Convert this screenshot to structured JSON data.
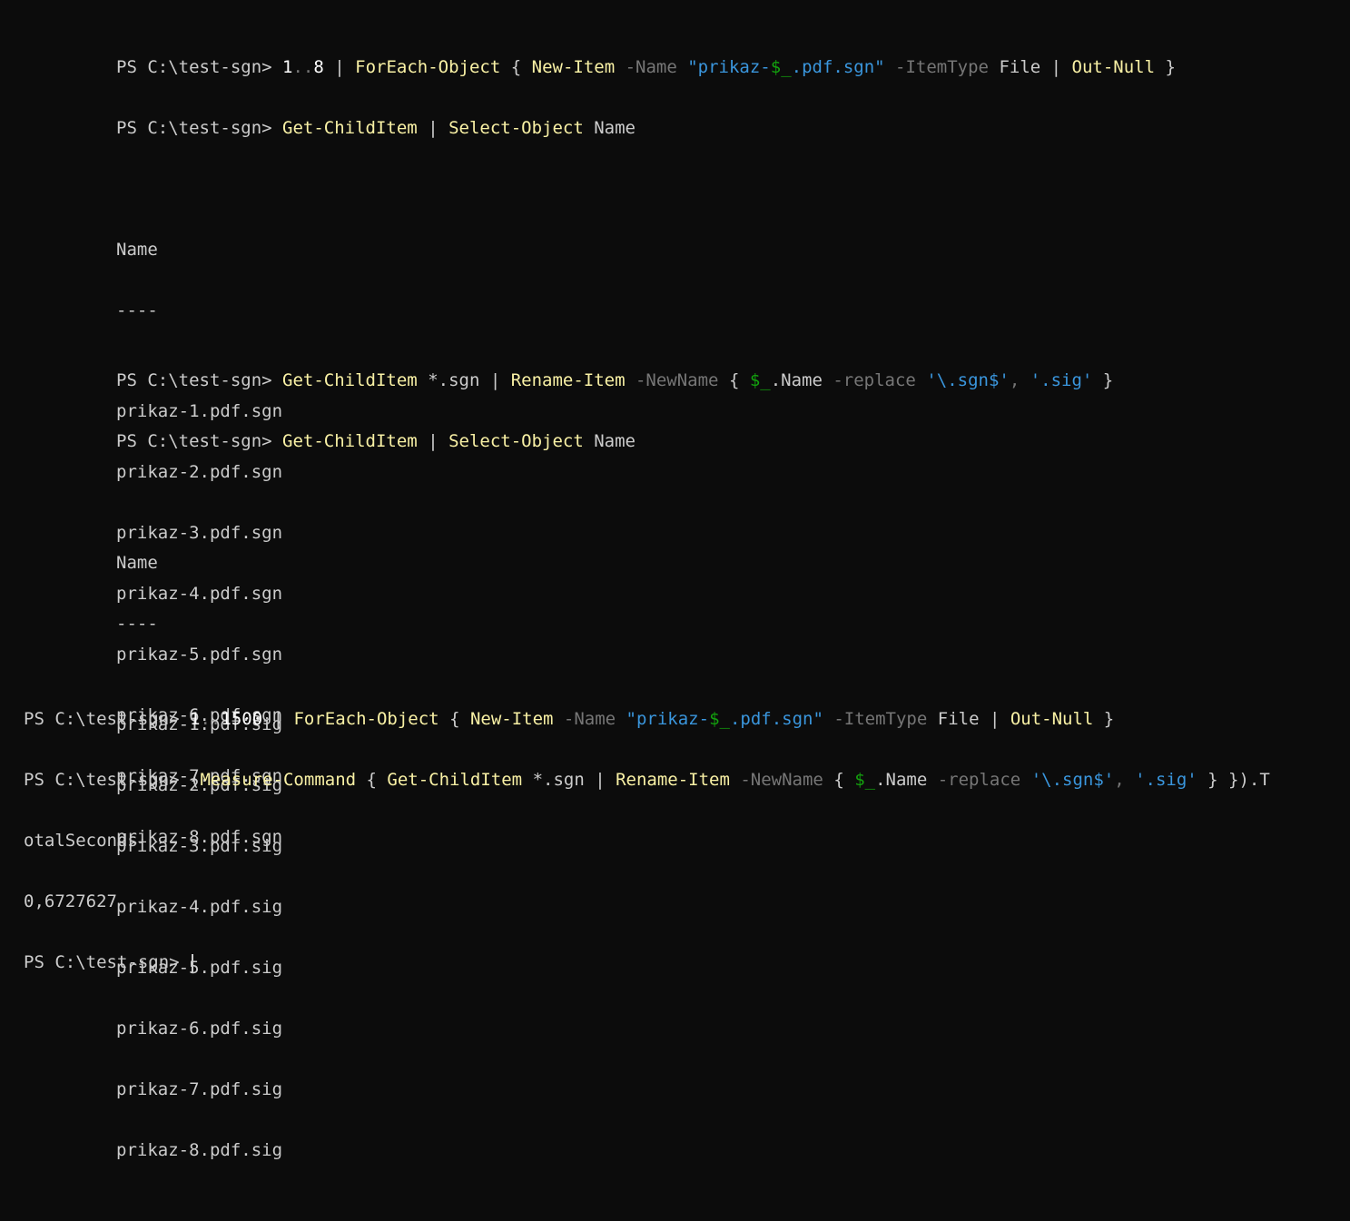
{
  "prompt": "PS C:\\test-sgn> ",
  "session1": {
    "line1": {
      "p1": "1",
      "p2": "..",
      "p3": "8",
      "p4": " | ",
      "p5": "ForEach-Object",
      "p6": " { ",
      "p7": "New-Item",
      "p8": " -Name ",
      "p9": "\"prikaz-",
      "p10": "$_",
      "p11": ".pdf.sgn\"",
      "p12": " -ItemType ",
      "p13": "File",
      "p14": " | ",
      "p15": "Out-Null",
      "p16": " }"
    },
    "line2": {
      "p1": "Get-ChildItem",
      "p2": " | ",
      "p3": "Select-Object",
      "p4": " Name"
    },
    "header": "Name",
    "underline": "----",
    "files": [
      "prikaz-1.pdf.sgn",
      "prikaz-2.pdf.sgn",
      "prikaz-3.pdf.sgn",
      "prikaz-4.pdf.sgn",
      "prikaz-5.pdf.sgn",
      "prikaz-6.pdf.sgn",
      "prikaz-7.pdf.sgn",
      "prikaz-8.pdf.sgn"
    ]
  },
  "session2": {
    "line1": {
      "p1": "Get-ChildItem",
      "p2": " *.sgn | ",
      "p3": "Rename-Item",
      "p4": " -NewName ",
      "p5": "{ ",
      "p6": "$_",
      "p7": ".Name",
      "p8": " -replace ",
      "p9": "'\\.sgn$'",
      "p10": ", ",
      "p11": "'.sig'",
      "p12": " }"
    },
    "line2": {
      "p1": "Get-ChildItem",
      "p2": " | ",
      "p3": "Select-Object",
      "p4": " Name"
    },
    "header": "Name",
    "underline": "----",
    "files": [
      "prikaz-1.pdf.sig",
      "prikaz-2.pdf.sig",
      "prikaz-3.pdf.sig",
      "prikaz-4.pdf.sig",
      "prikaz-5.pdf.sig",
      "prikaz-6.pdf.sig",
      "prikaz-7.pdf.sig",
      "prikaz-8.pdf.sig"
    ]
  },
  "session3": {
    "line1": {
      "p1": "1",
      "p2": "..",
      "p3": "1500",
      "p4": " | ",
      "p5": "ForEach-Object",
      "p6": " { ",
      "p7": "New-Item",
      "p8": " -Name ",
      "p9": "\"prikaz-",
      "p10": "$_",
      "p11": ".pdf.sgn\"",
      "p12": " -ItemType ",
      "p13": "File",
      "p14": " | ",
      "p15": "Out-Null",
      "p16": " }"
    },
    "line2": {
      "p1": "(",
      "p2": "Measure-Command",
      "p3": " { ",
      "p4": "Get-ChildItem",
      "p5": " *.sgn | ",
      "p6": "Rename-Item",
      "p7": " -NewName ",
      "p8": "{ ",
      "p9": "$_",
      "p10": ".Name",
      "p11": " -replace ",
      "p12": "'\\.sgn$'",
      "p13": ", ",
      "p14": "'.sig'",
      "p15": " } }).T"
    },
    "line3": "otalSeconds",
    "result": "0,6727627"
  },
  "colors": {
    "background": "#0c0c0c",
    "foreground": "#cccccc",
    "command": "#f9f1a5",
    "parameter": "#767676",
    "string": "#3a96dd",
    "variable": "#13a10e"
  }
}
